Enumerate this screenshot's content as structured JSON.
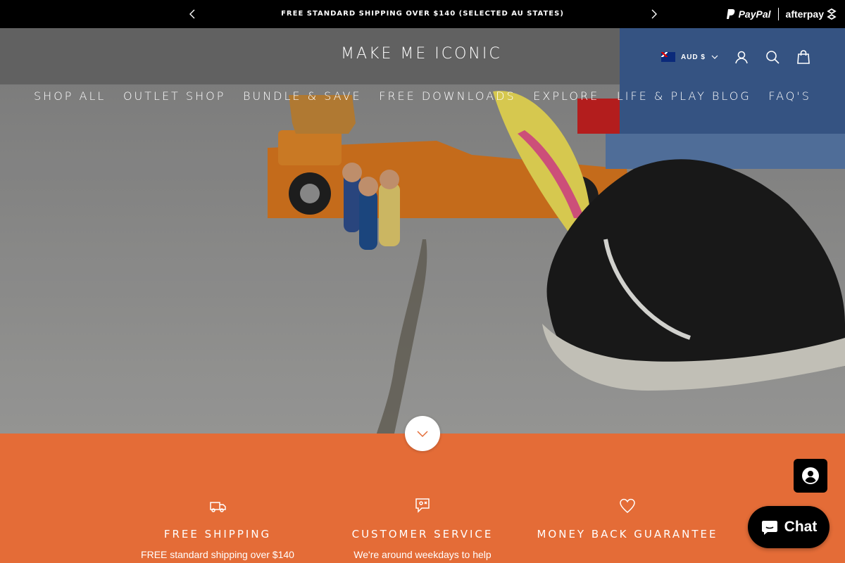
{
  "announcement": {
    "message": "FREE STANDARD SHIPPING OVER $140 (SELECTED AU STATES)",
    "prev_icon": "chevron-left-icon",
    "next_icon": "chevron-right-icon"
  },
  "payments": {
    "paypal": "PayPal",
    "afterpay": "afterpay"
  },
  "header": {
    "logo_part1": "MAKE ME IC",
    "logo_o": "O",
    "logo_part2": "NIC",
    "currency": "AUD $"
  },
  "nav": {
    "items": [
      "SHOP ALL",
      "OUTLET SHOP",
      "BUNDLE & SAVE",
      "FREE DOWNLOADS",
      "EXPLORE",
      "LIFE & PLAY BLOG",
      "FAQ'S"
    ]
  },
  "features": [
    {
      "title": "FREE SHIPPING",
      "text": "FREE standard shipping over $140",
      "icon": "truck-icon"
    },
    {
      "title": "CUSTOMER SERVICE",
      "text": "We're around weekdays to help",
      "icon": "chat-support-icon"
    },
    {
      "title": "MONEY BACK GUARANTEE",
      "text": "",
      "icon": "heart-icon"
    }
  ],
  "chat": {
    "label": "Chat"
  },
  "colors": {
    "announce_bg": "#000000",
    "accent": "#e46c37"
  }
}
